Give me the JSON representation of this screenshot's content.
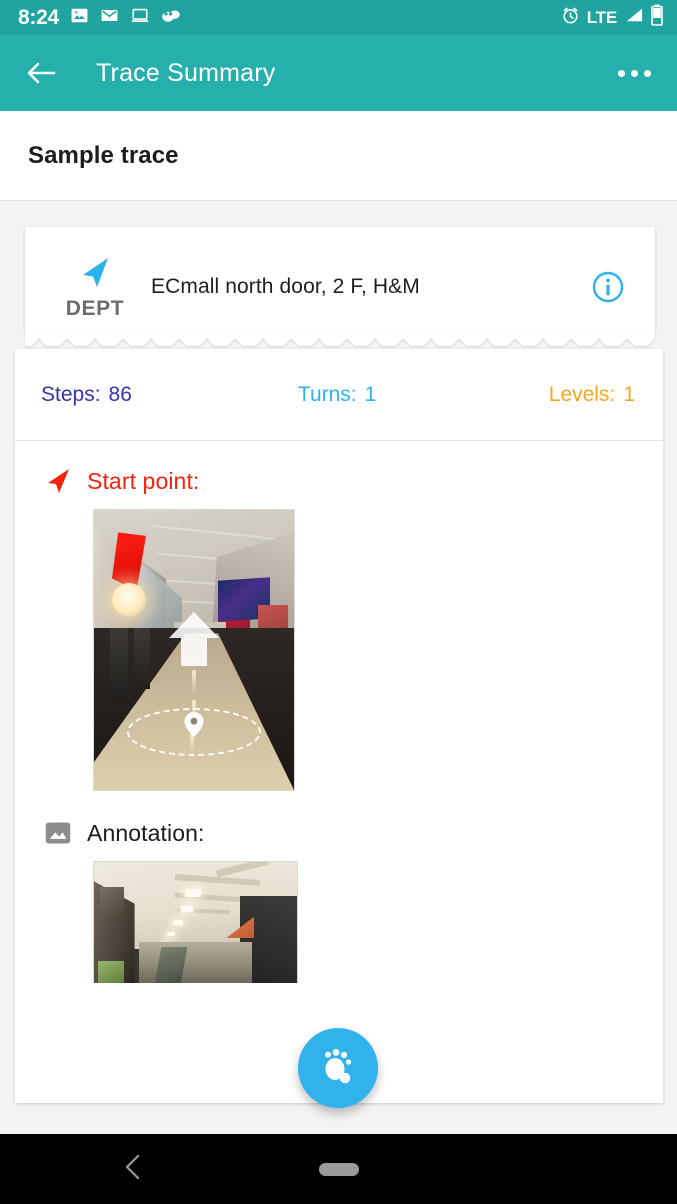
{
  "status_bar": {
    "time": "8:24",
    "network": "LTE",
    "icons": [
      "image-icon",
      "envelope-icon",
      "laptop-icon",
      "mask-icon",
      "alarm-icon",
      "signal-icon",
      "battery-icon"
    ],
    "background_color": "#20a49f"
  },
  "toolbar": {
    "back_label": "Back",
    "title": "Trace Summary",
    "overflow_label": "More options",
    "background_color": "#26b0ab"
  },
  "page": {
    "title": "Sample trace"
  },
  "dept_card": {
    "badge_label": "DEPT",
    "badge_icon": "navigation-arrow-icon",
    "location_text": "ECmall north door, 2 F, H&M",
    "info_icon": "info-circle-icon",
    "info_color": "#2bb3f0",
    "arrow_color": "#2bb3f0"
  },
  "stats": [
    {
      "name": "steps",
      "label": "Steps:",
      "value": "86",
      "color": "#3434b0"
    },
    {
      "name": "turns",
      "label": "Turns:",
      "value": "1",
      "color": "#2bb3f0"
    },
    {
      "name": "levels",
      "label": "Levels:",
      "value": "1",
      "color": "#f6a623"
    }
  ],
  "sections": [
    {
      "name": "start-point",
      "icon": "navigation-arrow-icon",
      "label": "Start point:",
      "color": "#f5220f",
      "image_alt": "Mall corridor with navigation arrow and location marker"
    },
    {
      "name": "annotation",
      "icon": "image-icon",
      "label": "Annotation:",
      "color": "#1b1b1b",
      "image_alt": "Mall interior ceiling and escalator view"
    }
  ],
  "fab": {
    "icon": "footprint-icon",
    "label": "Record footsteps",
    "color": "#31b2ec"
  },
  "navbar": {
    "back_label": "Back",
    "home_label": "Home"
  }
}
